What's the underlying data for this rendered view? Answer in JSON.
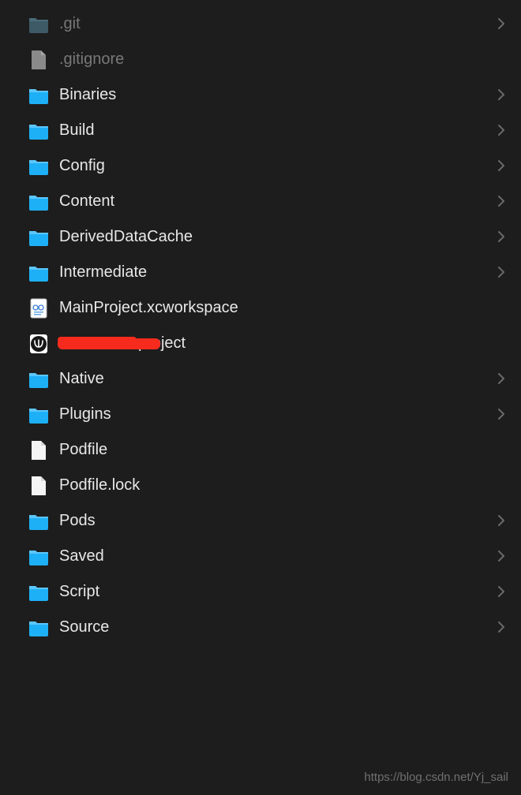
{
  "items": [
    {
      "name": ".git",
      "type": "folder-dim",
      "expandable": true,
      "dimmed": true
    },
    {
      "name": ".gitignore",
      "type": "file-generic-dim",
      "expandable": false,
      "dimmed": true
    },
    {
      "name": "Binaries",
      "type": "folder",
      "expandable": true,
      "dimmed": false
    },
    {
      "name": "Build",
      "type": "folder",
      "expandable": true,
      "dimmed": false
    },
    {
      "name": "Config",
      "type": "folder",
      "expandable": true,
      "dimmed": false
    },
    {
      "name": "Content",
      "type": "folder",
      "expandable": true,
      "dimmed": false
    },
    {
      "name": "DerivedDataCache",
      "type": "folder",
      "expandable": true,
      "dimmed": false
    },
    {
      "name": "Intermediate",
      "type": "folder",
      "expandable": true,
      "dimmed": false
    },
    {
      "name": "MainProject.xcworkspace",
      "type": "xcworkspace",
      "expandable": false,
      "dimmed": false
    },
    {
      "name": "",
      "suffix": ".uproject",
      "type": "uproject",
      "expandable": false,
      "dimmed": false,
      "redacted": true
    },
    {
      "name": "Native",
      "type": "folder",
      "expandable": true,
      "dimmed": false
    },
    {
      "name": "Plugins",
      "type": "folder",
      "expandable": true,
      "dimmed": false
    },
    {
      "name": "Podfile",
      "type": "file-blank",
      "expandable": false,
      "dimmed": false
    },
    {
      "name": "Podfile.lock",
      "type": "file-blank",
      "expandable": false,
      "dimmed": false
    },
    {
      "name": "Pods",
      "type": "folder",
      "expandable": true,
      "dimmed": false
    },
    {
      "name": "Saved",
      "type": "folder",
      "expandable": true,
      "dimmed": false
    },
    {
      "name": "Script",
      "type": "folder",
      "expandable": true,
      "dimmed": false
    },
    {
      "name": "Source",
      "type": "folder",
      "expandable": true,
      "dimmed": false
    }
  ],
  "watermark": "https://blog.csdn.net/Yj_sail",
  "colors": {
    "folder": "#1eb0f7",
    "folder_dim": "#3d5a66",
    "file_dim": "#8a8a8a",
    "file_blank": "#f5f5f5"
  }
}
